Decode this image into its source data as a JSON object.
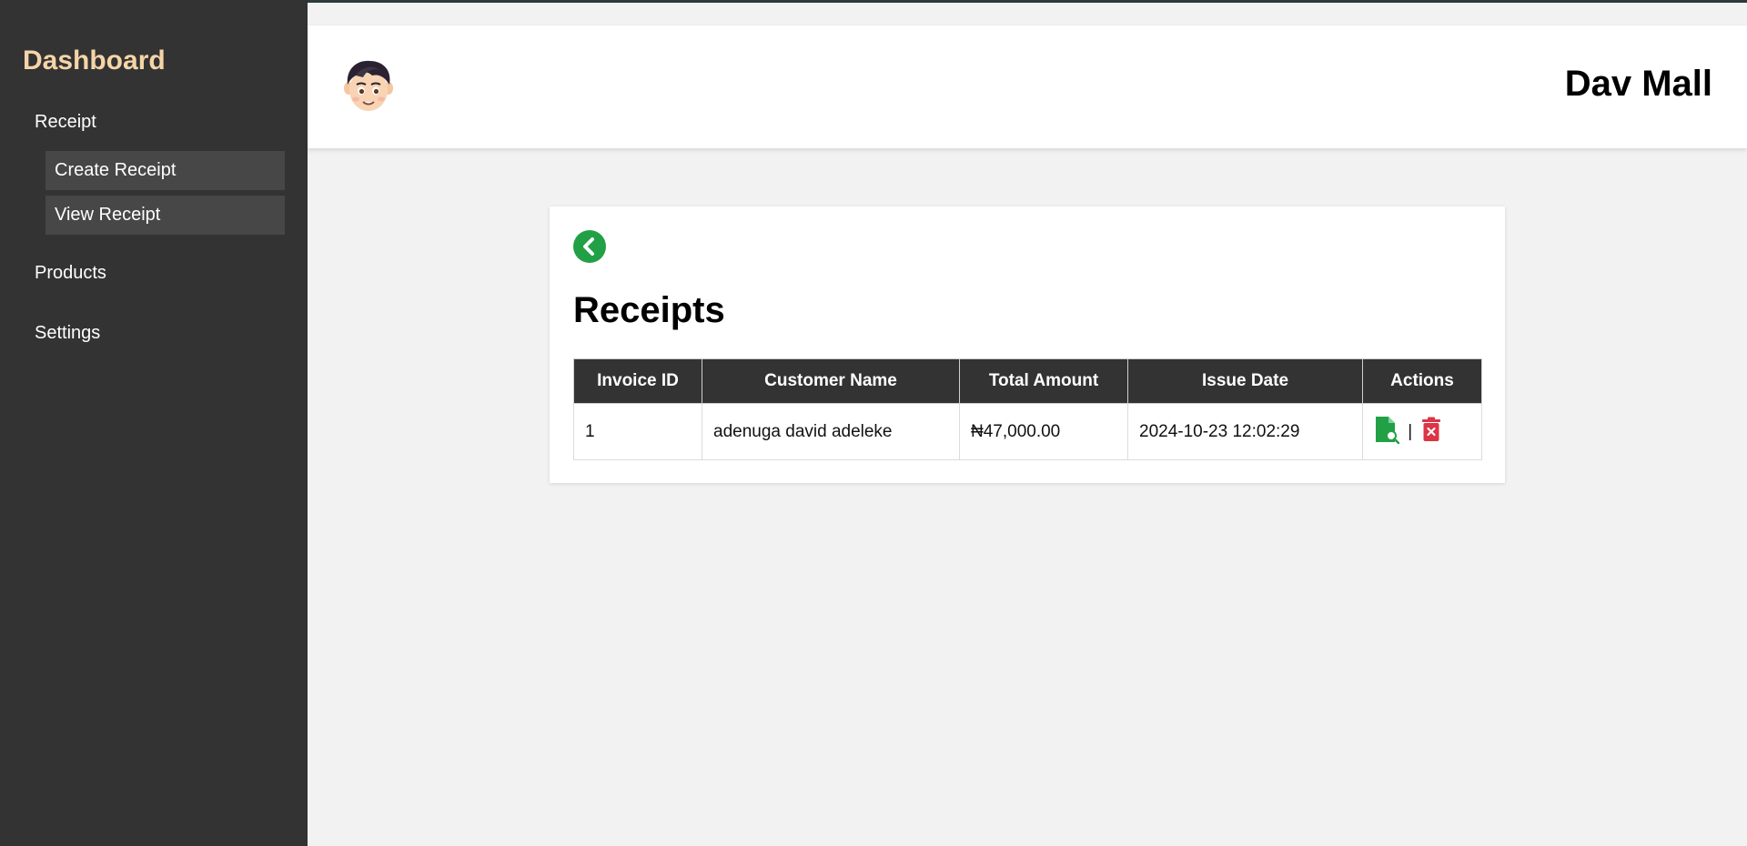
{
  "sidebar": {
    "title": "Dashboard",
    "items": [
      {
        "label": "Receipt"
      },
      {
        "label": "Create Receipt"
      },
      {
        "label": "View Receipt"
      },
      {
        "label": "Products"
      },
      {
        "label": "Settings"
      }
    ]
  },
  "header": {
    "avatar_icon": "boy-avatar-icon",
    "brand": "Dav Mall"
  },
  "main": {
    "back_icon": "chevron-left-circle-icon",
    "title": "Receipts",
    "table": {
      "columns": [
        "Invoice ID",
        "Customer Name",
        "Total Amount",
        "Issue Date",
        "Actions"
      ],
      "rows": [
        {
          "invoice_id": "1",
          "customer_name": "adenuga david adeleke",
          "total_amount": "₦47,000.00",
          "issue_date": "2024-10-23 12:02:29",
          "separator": "|"
        }
      ]
    },
    "action_icons": [
      "view-document-icon",
      "delete-icon"
    ]
  },
  "colors": {
    "sidebar_bg": "#333333",
    "sidebar_title": "#f5d5a8",
    "submenu_bg": "#474747",
    "accent_green": "#22a046",
    "danger_red": "#dc3545",
    "page_bg": "#f2f2f2"
  }
}
